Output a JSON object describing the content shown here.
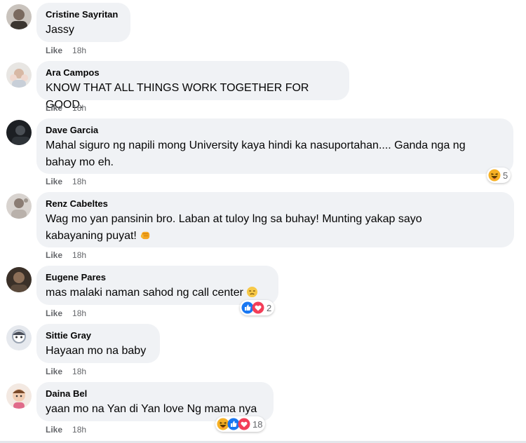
{
  "comments": [
    {
      "name": "Cristine Sayritan",
      "text": "Jassy",
      "like": "Like",
      "time": "18h"
    },
    {
      "name": "Ara Campos",
      "text": "KNOW THAT ALL THINGS WORK TOGETHER FOR GOOD.",
      "like": "Like",
      "time": "18h"
    },
    {
      "name": "Dave Garcia",
      "text_line1": "Mahal siguro ng napili mong University kaya hindi ka nasuportahan.... Ganda nga ng",
      "text_line2": "bahay mo eh.",
      "like": "Like",
      "time": "18h",
      "reaction_count": "5"
    },
    {
      "name": "Renz Cabeltes",
      "text_line1": "Wag mo yan pansinin bro. Laban at tuloy lng sa buhay! Munting yakap sayo",
      "text_line2": "kabayaning puyat!",
      "like": "Like",
      "time": "18h"
    },
    {
      "name": "Eugene Pares",
      "text": "mas malaki naman sahod ng call center",
      "like": "Like",
      "time": "18h",
      "reaction_count": "2"
    },
    {
      "name": "Sittie Gray",
      "text": "Hayaan mo na baby",
      "like": "Like",
      "time": "18h"
    },
    {
      "name": "Daina Bel",
      "text": "yaan mo na Yan di Yan love Ng mama nya",
      "like": "Like",
      "time": "18h",
      "reaction_count": "18"
    }
  ],
  "colors": {
    "bubble": "#f0f2f5",
    "name": "#050505",
    "meta": "#65676b",
    "like_blue": "#1877f2",
    "love_red": "#f33e58",
    "haha_yellow": "#f7b125"
  }
}
